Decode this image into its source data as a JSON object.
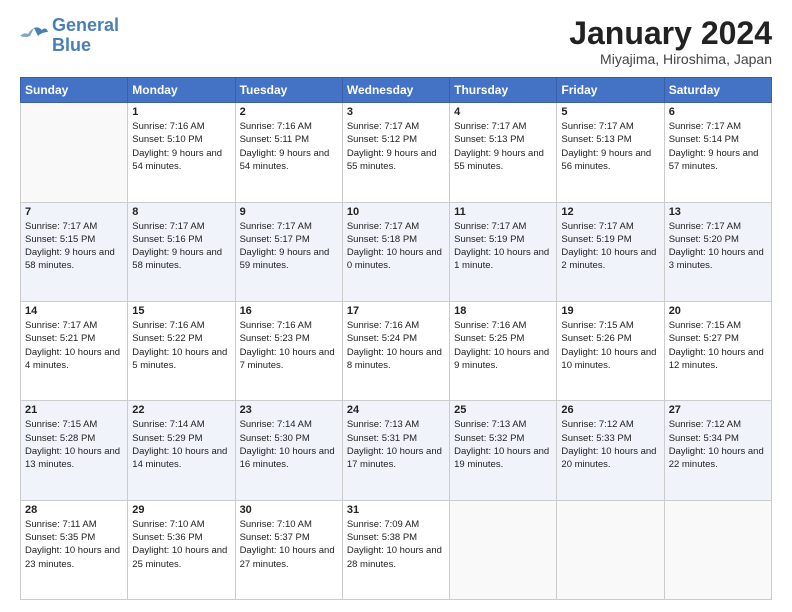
{
  "logo": {
    "line1": "General",
    "line2": "Blue"
  },
  "title": "January 2024",
  "subtitle": "Miyajima, Hiroshima, Japan",
  "days_header": [
    "Sunday",
    "Monday",
    "Tuesday",
    "Wednesday",
    "Thursday",
    "Friday",
    "Saturday"
  ],
  "weeks": [
    [
      {
        "day": "",
        "sunrise": "",
        "sunset": "",
        "daylight": ""
      },
      {
        "day": "1",
        "sunrise": "7:16 AM",
        "sunset": "5:10 PM",
        "daylight": "9 hours and 54 minutes."
      },
      {
        "day": "2",
        "sunrise": "7:16 AM",
        "sunset": "5:11 PM",
        "daylight": "9 hours and 54 minutes."
      },
      {
        "day": "3",
        "sunrise": "7:17 AM",
        "sunset": "5:12 PM",
        "daylight": "9 hours and 55 minutes."
      },
      {
        "day": "4",
        "sunrise": "7:17 AM",
        "sunset": "5:13 PM",
        "daylight": "9 hours and 55 minutes."
      },
      {
        "day": "5",
        "sunrise": "7:17 AM",
        "sunset": "5:13 PM",
        "daylight": "9 hours and 56 minutes."
      },
      {
        "day": "6",
        "sunrise": "7:17 AM",
        "sunset": "5:14 PM",
        "daylight": "9 hours and 57 minutes."
      }
    ],
    [
      {
        "day": "7",
        "sunrise": "7:17 AM",
        "sunset": "5:15 PM",
        "daylight": "9 hours and 58 minutes."
      },
      {
        "day": "8",
        "sunrise": "7:17 AM",
        "sunset": "5:16 PM",
        "daylight": "9 hours and 58 minutes."
      },
      {
        "day": "9",
        "sunrise": "7:17 AM",
        "sunset": "5:17 PM",
        "daylight": "9 hours and 59 minutes."
      },
      {
        "day": "10",
        "sunrise": "7:17 AM",
        "sunset": "5:18 PM",
        "daylight": "10 hours and 0 minutes."
      },
      {
        "day": "11",
        "sunrise": "7:17 AM",
        "sunset": "5:19 PM",
        "daylight": "10 hours and 1 minute."
      },
      {
        "day": "12",
        "sunrise": "7:17 AM",
        "sunset": "5:19 PM",
        "daylight": "10 hours and 2 minutes."
      },
      {
        "day": "13",
        "sunrise": "7:17 AM",
        "sunset": "5:20 PM",
        "daylight": "10 hours and 3 minutes."
      }
    ],
    [
      {
        "day": "14",
        "sunrise": "7:17 AM",
        "sunset": "5:21 PM",
        "daylight": "10 hours and 4 minutes."
      },
      {
        "day": "15",
        "sunrise": "7:16 AM",
        "sunset": "5:22 PM",
        "daylight": "10 hours and 5 minutes."
      },
      {
        "day": "16",
        "sunrise": "7:16 AM",
        "sunset": "5:23 PM",
        "daylight": "10 hours and 7 minutes."
      },
      {
        "day": "17",
        "sunrise": "7:16 AM",
        "sunset": "5:24 PM",
        "daylight": "10 hours and 8 minutes."
      },
      {
        "day": "18",
        "sunrise": "7:16 AM",
        "sunset": "5:25 PM",
        "daylight": "10 hours and 9 minutes."
      },
      {
        "day": "19",
        "sunrise": "7:15 AM",
        "sunset": "5:26 PM",
        "daylight": "10 hours and 10 minutes."
      },
      {
        "day": "20",
        "sunrise": "7:15 AM",
        "sunset": "5:27 PM",
        "daylight": "10 hours and 12 minutes."
      }
    ],
    [
      {
        "day": "21",
        "sunrise": "7:15 AM",
        "sunset": "5:28 PM",
        "daylight": "10 hours and 13 minutes."
      },
      {
        "day": "22",
        "sunrise": "7:14 AM",
        "sunset": "5:29 PM",
        "daylight": "10 hours and 14 minutes."
      },
      {
        "day": "23",
        "sunrise": "7:14 AM",
        "sunset": "5:30 PM",
        "daylight": "10 hours and 16 minutes."
      },
      {
        "day": "24",
        "sunrise": "7:13 AM",
        "sunset": "5:31 PM",
        "daylight": "10 hours and 17 minutes."
      },
      {
        "day": "25",
        "sunrise": "7:13 AM",
        "sunset": "5:32 PM",
        "daylight": "10 hours and 19 minutes."
      },
      {
        "day": "26",
        "sunrise": "7:12 AM",
        "sunset": "5:33 PM",
        "daylight": "10 hours and 20 minutes."
      },
      {
        "day": "27",
        "sunrise": "7:12 AM",
        "sunset": "5:34 PM",
        "daylight": "10 hours and 22 minutes."
      }
    ],
    [
      {
        "day": "28",
        "sunrise": "7:11 AM",
        "sunset": "5:35 PM",
        "daylight": "10 hours and 23 minutes."
      },
      {
        "day": "29",
        "sunrise": "7:10 AM",
        "sunset": "5:36 PM",
        "daylight": "10 hours and 25 minutes."
      },
      {
        "day": "30",
        "sunrise": "7:10 AM",
        "sunset": "5:37 PM",
        "daylight": "10 hours and 27 minutes."
      },
      {
        "day": "31",
        "sunrise": "7:09 AM",
        "sunset": "5:38 PM",
        "daylight": "10 hours and 28 minutes."
      },
      {
        "day": "",
        "sunrise": "",
        "sunset": "",
        "daylight": ""
      },
      {
        "day": "",
        "sunrise": "",
        "sunset": "",
        "daylight": ""
      },
      {
        "day": "",
        "sunrise": "",
        "sunset": "",
        "daylight": ""
      }
    ]
  ]
}
